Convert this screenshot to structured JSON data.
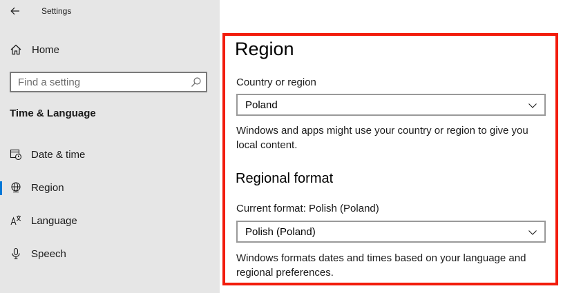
{
  "window": {
    "title": "Settings"
  },
  "sidebar": {
    "home_label": "Home",
    "search": {
      "placeholder": "Find a setting",
      "value": ""
    },
    "section_title": "Time & Language",
    "items": [
      {
        "label": "Date & time",
        "icon": "calendar-clock-icon",
        "selected": false
      },
      {
        "label": "Region",
        "icon": "globe-icon",
        "selected": true
      },
      {
        "label": "Language",
        "icon": "language-icon",
        "selected": false
      },
      {
        "label": "Speech",
        "icon": "microphone-icon",
        "selected": false
      }
    ]
  },
  "main": {
    "title": "Region",
    "country": {
      "label": "Country or region",
      "selected": "Poland",
      "description": "Windows and apps might use your country or region to give you local content."
    },
    "regional_format": {
      "heading": "Regional format",
      "label": "Current format: Polish (Poland)",
      "selected": "Polish (Poland)",
      "description": "Windows formats dates and times based on your language and regional preferences."
    }
  },
  "colors": {
    "accent": "#0078d7",
    "highlight_frame": "#f21c0c",
    "sidebar_bg": "#e6e6e6"
  }
}
